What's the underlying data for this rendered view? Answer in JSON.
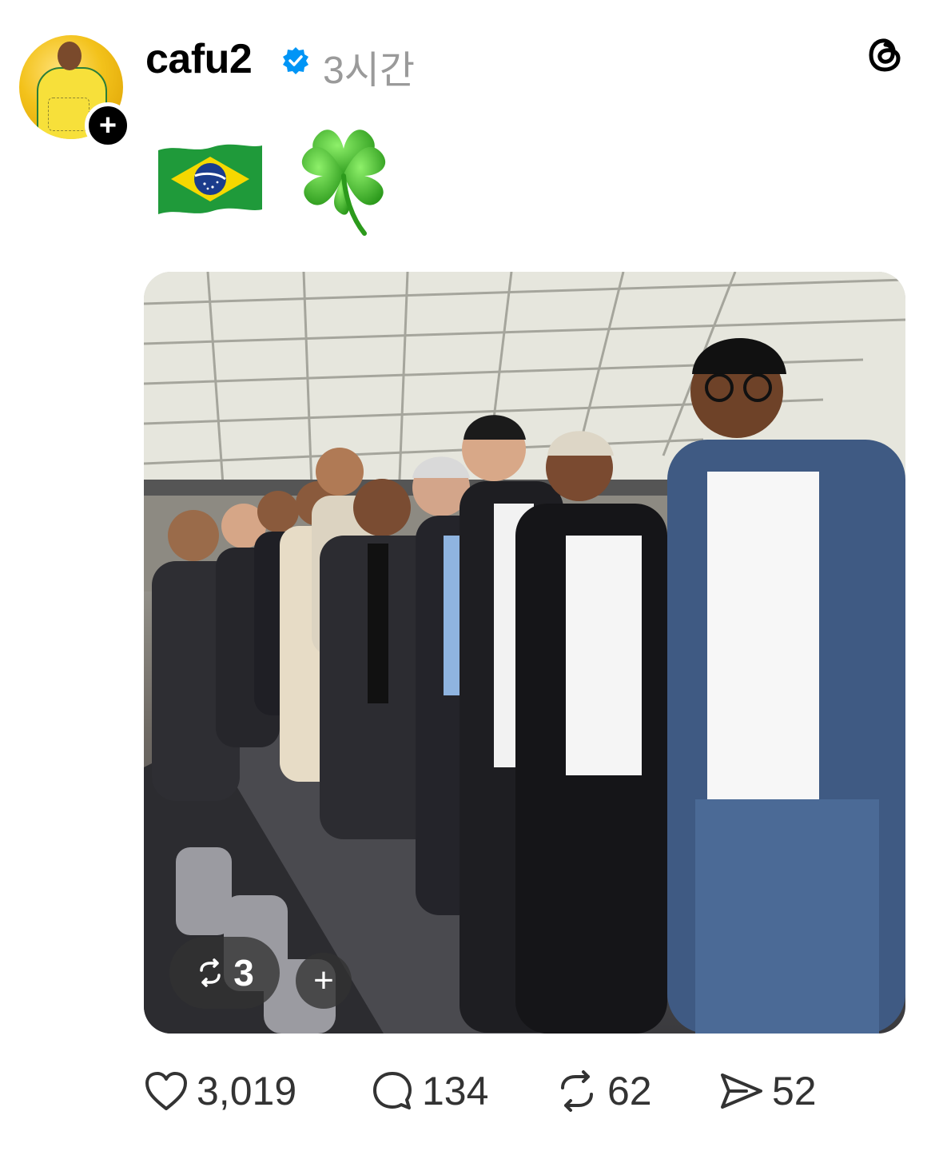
{
  "post": {
    "username": "cafu2",
    "time": "3시간",
    "emoji_flag": "🇧🇷",
    "emoji_clover": "🍀",
    "image_alt": "Group photo in stadium box",
    "repost_count_overlay": "3",
    "follow_symbol": "+",
    "add_symbol": "+"
  },
  "actions": {
    "likes": "3,019",
    "replies": "134",
    "reposts": "62",
    "shares": "52"
  },
  "colors": {
    "verified_blue": "#0095f6",
    "muted": "#9a9a9a",
    "text": "#000000"
  }
}
